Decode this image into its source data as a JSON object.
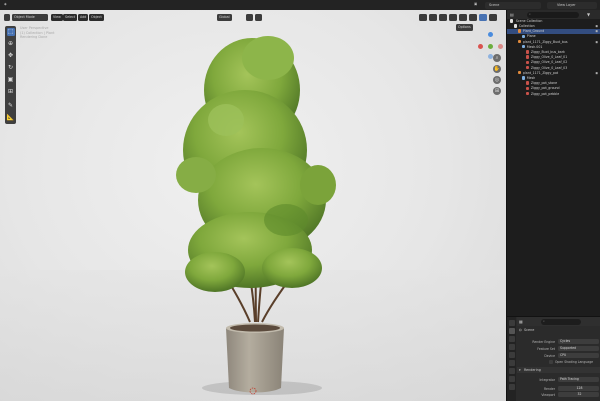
{
  "topbar": {
    "scene_label": "Scene",
    "view_layer_label": "View Layer"
  },
  "viewport": {
    "mode": "Object Mode",
    "menus": [
      "View",
      "Select",
      "Add",
      "Object"
    ],
    "orientation": "Global",
    "options": "Options",
    "info_lines": [
      "User Perspective",
      "(1) Collection | Plant",
      "Rendering Done"
    ]
  },
  "outliner": {
    "title": "Scene Collection",
    "rows": [
      {
        "label": "Collection",
        "indent": 1,
        "kind": "collection"
      },
      {
        "label": "Plant_Ground",
        "indent": 2,
        "kind": "object",
        "selected": true
      },
      {
        "label": "Plane",
        "indent": 3,
        "kind": "mesh"
      },
      {
        "label": "plant_1171_Ziggy_Buxt_bus",
        "indent": 2,
        "kind": "object"
      },
      {
        "label": "Mesh.001",
        "indent": 3,
        "kind": "mesh"
      },
      {
        "label": "Ziggy_Buxt_bus_bark",
        "indent": 4,
        "kind": "material"
      },
      {
        "label": "Ziggy_Olive_0_Leaf_01",
        "indent": 4,
        "kind": "material"
      },
      {
        "label": "Ziggy_Olive_0_Leaf_02",
        "indent": 4,
        "kind": "material"
      },
      {
        "label": "Ziggy_Olive_0_Leaf_03",
        "indent": 4,
        "kind": "material"
      },
      {
        "label": "plant_1171_Ziggy_pot",
        "indent": 2,
        "kind": "object"
      },
      {
        "label": "Mesh",
        "indent": 3,
        "kind": "mesh"
      },
      {
        "label": "Ziggy_pot_stone",
        "indent": 4,
        "kind": "material"
      },
      {
        "label": "Ziggy_pot_ground",
        "indent": 4,
        "kind": "material"
      },
      {
        "label": "Ziggy_pot_pebble",
        "indent": 4,
        "kind": "material"
      }
    ]
  },
  "properties": {
    "scene_label": "Scene",
    "render_engine_label": "Render Engine",
    "render_engine": "Cycles",
    "feature_set_label": "Feature Set",
    "feature_set": "Supported",
    "device_label": "Device",
    "device": "CPU",
    "osl_label": "Open Shading Language",
    "section_rendering": "Rendering",
    "integrator_label": "Integrator",
    "integrator": "Path Tracing",
    "render_label": "Render",
    "render_samples": "128",
    "viewport_label": "Viewport",
    "viewport_samples": "32"
  },
  "colors": {
    "selection": "#334d80",
    "accent": "#4772b3",
    "leaf": "#7fa83c",
    "pot": "#a39c90"
  },
  "icons": [
    "editor-type-icon",
    "search-icon",
    "filter-icon",
    "eye-icon",
    "render-icon",
    "scene-icon"
  ]
}
